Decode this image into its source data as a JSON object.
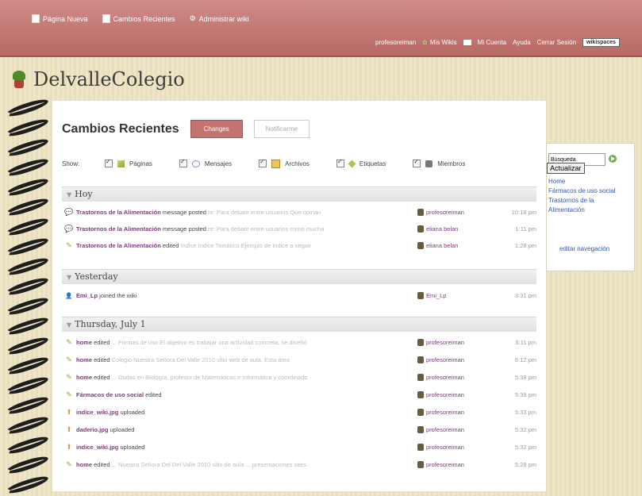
{
  "topbar": {
    "new_page": "Página Nueva",
    "recent_changes": "Cambios Recientes",
    "manage_wiki": "Administrar wiki",
    "username": "profesoreiman",
    "my_wikis": "Mis Wikis",
    "my_account": "Mi Cuenta",
    "help": "Ayuda",
    "sign_out": "Cerrar Sesión",
    "brand": "wikispaces"
  },
  "site": {
    "title": "DelvalleColegio"
  },
  "main": {
    "heading": "Cambios Recientes",
    "tab_changes": "Changes",
    "tab_notify": "Notificarme",
    "filters": {
      "show_label": "Show:",
      "items": [
        "Páginas",
        "Mensajes",
        "Archivos",
        "Etiquetas",
        "Miembros"
      ]
    },
    "sections": [
      {
        "title": "Hoy",
        "rows": [
          {
            "link": "Trastornos de la Alimentación",
            "action": " message posted",
            "detail": " re: Para debatir entre usuarios Que opinan",
            "user": "profesoreiman",
            "time": "10:18 pm"
          },
          {
            "link": "Trastornos de la Alimentación",
            "action": " message posted",
            "detail": " re: Para debatir entre usuarios como mucha",
            "user": "eliana belan",
            "time": "1:11 pm"
          },
          {
            "link": "Trastornos de la Alimentación",
            "action": " edited",
            "detail": " Indice Indice Temático Ejemplo de Indice a seguir",
            "user": "eliana belan",
            "time": "1:28 pm"
          }
        ]
      },
      {
        "title": "Yesterday",
        "rows": [
          {
            "link": "Emi_Lp",
            "action": " joined the wiki",
            "detail": "",
            "user": "Emi_Lp",
            "time": "3:31 pm"
          }
        ]
      },
      {
        "title": "Thursday, July 1",
        "rows": [
          {
            "link": "home",
            "action": " edited",
            "detail": " ... Formas de uso El objetivo es trabajar una actividad concreta, se diseñó",
            "user": "profesoreiman",
            "time": "6:11 pm"
          },
          {
            "link": "home",
            "action": " edited",
            "detail": " Colegio Nuestra Señora Del Valle 2010 sitio web de aula. Esta área",
            "user": "profesoreiman",
            "time": "6:12 pm"
          },
          {
            "link": "home",
            "action": " edited",
            "detail": " ... Dudas en Biología, profesor de Matemáticas e Informática y coordinado",
            "user": "profesoreiman",
            "time": "5:38 pm"
          },
          {
            "link": "Fármacos de uso social",
            "action": " edited",
            "detail": "",
            "user": "profesoreiman",
            "time": "5:39 pm"
          },
          {
            "link": "indice_wiki.jpg",
            "action": " uploaded",
            "detail": "",
            "user": "profesoreiman",
            "time": "5:33 pm"
          },
          {
            "link": "daderio.jpg",
            "action": " uploaded",
            "detail": "",
            "user": "profesoreiman",
            "time": "5:32 pm"
          },
          {
            "link": "indice_wiki.jpg",
            "action": " uploaded",
            "detail": "",
            "user": "profesoreiman",
            "time": "5:32 pm"
          },
          {
            "link": "home",
            "action": " edited",
            "detail": " ... Nuestra Señora Del Del Valle 2010 sitio de aula ... presentaciones sites",
            "user": "profesoreiman",
            "time": "5:28 pm"
          }
        ]
      }
    ]
  },
  "sidebar": {
    "search_value": "Búsqueda",
    "update_button": "Actualizar",
    "nav": [
      "Home",
      "Fármacos de uso social",
      "Trastornos de la Alimentación"
    ],
    "edit_nav": "editar navegación"
  }
}
